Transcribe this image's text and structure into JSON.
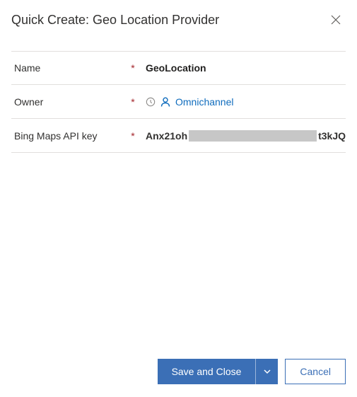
{
  "header": {
    "title": "Quick Create: Geo Location Provider"
  },
  "form": {
    "name": {
      "label": "Name",
      "required": "*",
      "value": "GeoLocation"
    },
    "owner": {
      "label": "Owner",
      "required": "*",
      "value": "Omnichannel"
    },
    "apiKey": {
      "label": "Bing Maps API key",
      "required": "*",
      "prefix": "Anx21oh",
      "suffix": "t3kJQ"
    }
  },
  "footer": {
    "saveClose": "Save and Close",
    "cancel": "Cancel"
  }
}
